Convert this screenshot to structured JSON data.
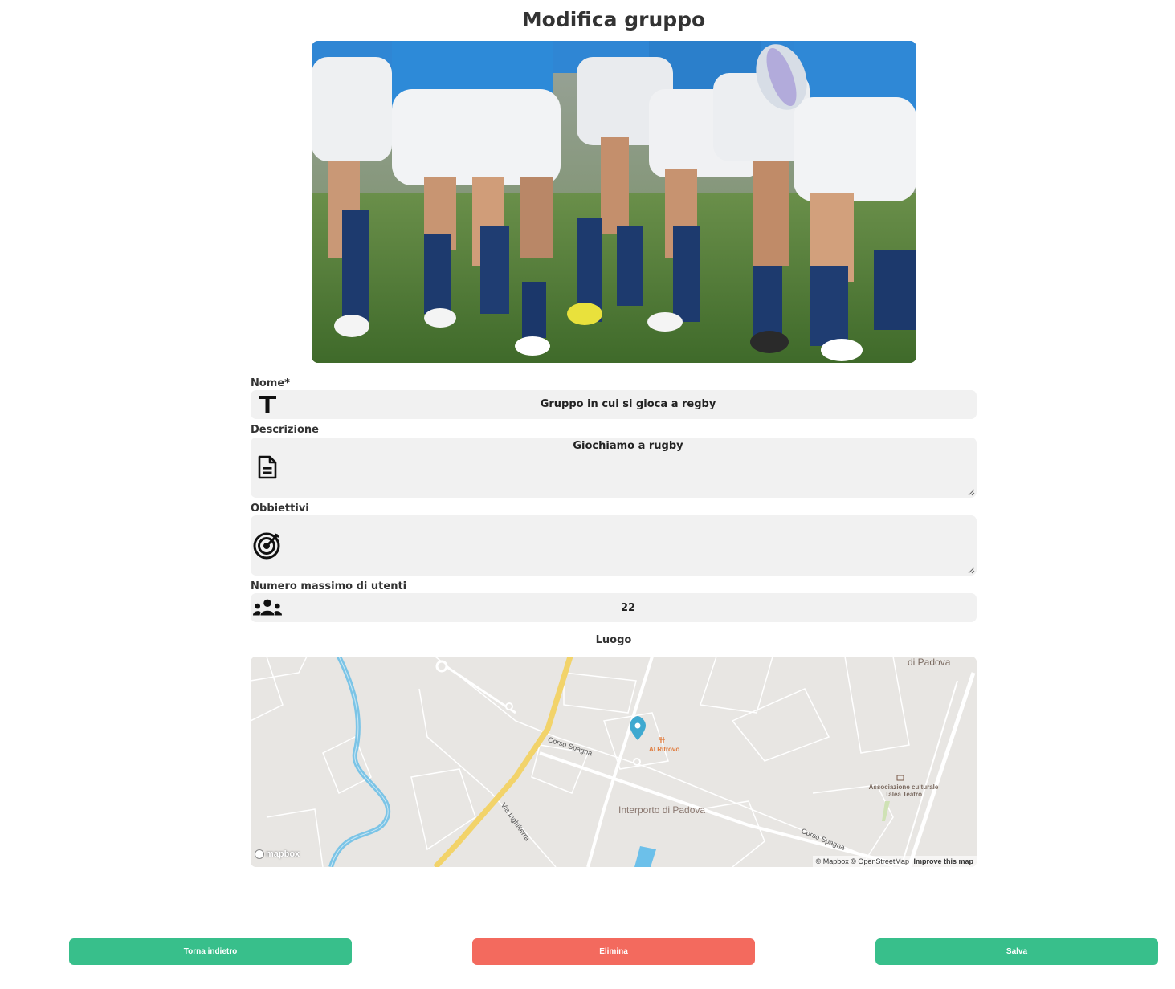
{
  "page": {
    "title": "Modifica gruppo"
  },
  "cover_image": {
    "description_icon": "rugby-photo"
  },
  "form": {
    "name": {
      "label": "Nome*",
      "value": "Gruppo in cui si gioca a regby",
      "icon": "text-icon"
    },
    "description": {
      "label": "Descrizione",
      "value": "Giochiamo a rugby",
      "icon": "document-icon"
    },
    "goals": {
      "label": "Obbiettivi",
      "value": "",
      "icon": "target-icon"
    },
    "max_users": {
      "label": "Numero massimo di utenti",
      "value": "22",
      "icon": "group-icon"
    }
  },
  "map": {
    "label": "Luogo",
    "places": {
      "top_right": "di Padova",
      "street_1": "Corso Spagna",
      "street_2": "Via Inghilterra",
      "street_3": "Corso Spagna",
      "restaurant": "Al Ritrovo",
      "area": "Interporto di Padova",
      "assoc_1": "Associazione culturale",
      "assoc_2": "Talea Teatro"
    },
    "logo": "mapbox",
    "attribution": "© Mapbox © OpenStreetMap",
    "improve": "Improve this map"
  },
  "buttons": {
    "back": "Torna indietro",
    "delete": "Elimina",
    "save": "Salva"
  },
  "colors": {
    "primary": "#38bf8b",
    "danger": "#f36a5e"
  }
}
